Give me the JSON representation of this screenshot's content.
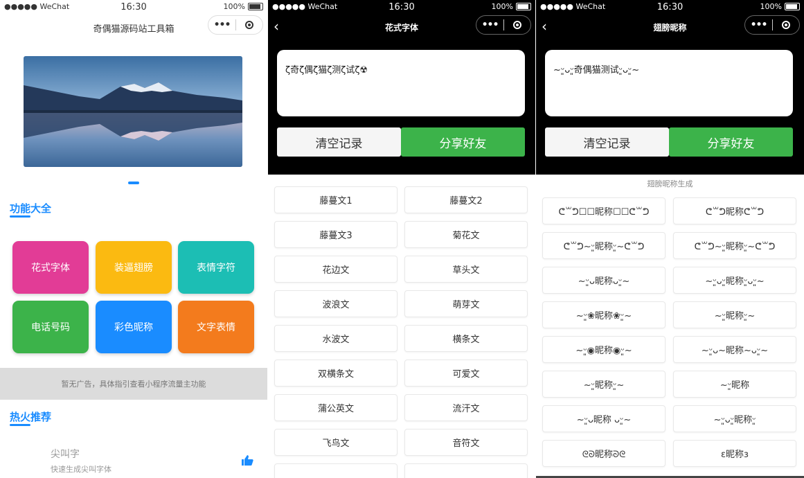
{
  "status": {
    "carrier": "●●●●● WeChat",
    "time": "16:30",
    "battery": "100%"
  },
  "screen1": {
    "title": "奇偶猫源码站工具箱",
    "functions_title": "功能大全",
    "tiles": [
      {
        "label": "花式字体",
        "color": "#e23c96"
      },
      {
        "label": "装逼翅膀",
        "color": "#fbba11"
      },
      {
        "label": "表情字符",
        "color": "#1cbeb4"
      },
      {
        "label": "电话号码",
        "color": "#3cb34a"
      },
      {
        "label": "彩色昵称",
        "color": "#1a8cff"
      },
      {
        "label": "文字表情",
        "color": "#f37b1d"
      }
    ],
    "ad_text": "暂无广告，具体指引查看小程序流量主功能",
    "hot_title": "热火推荐",
    "hot_item": {
      "name": "尖叫字",
      "desc": "快速生成尖叫字体"
    }
  },
  "screen2": {
    "title": "花式字体",
    "input_value": "ζ奇ζ偶ζ猫ζ测ζ试ζ☢",
    "clear_label": "清空记录",
    "share_label": "分享好友",
    "styles": [
      "藤蔓文1",
      "藤蔓文2",
      "藤蔓文3",
      "菊花文",
      "花边文",
      "草头文",
      "波浪文",
      "萌芽文",
      "水波文",
      "横条文",
      "双横条文",
      "可爱文",
      "蒲公英文",
      "流汗文",
      "飞鸟文",
      "音符文",
      "…",
      "…"
    ]
  },
  "screen3": {
    "title": "翅膀昵称",
    "input_value": "~ᵕ͈ᴗᵕ͈奇偶猫测试ᵕ͈ᴗᵕ͈~",
    "clear_label": "清空记录",
    "share_label": "分享好友",
    "subhead": "翅膀昵称生成",
    "results": [
      "ᕦ꒳ᕤ☐☐昵称☐☐ᕦ꒳ᕤ",
      "ᕦ꒳ᕤ昵称ᕦ꒳ᕤ",
      "ᕦ꒳ᕤ~ᵕ͈昵称ᵕ͈~ᕦ꒳ᕤ",
      "ᕦ꒳ᕤ~ᵕ͈昵称ᵕ͈~ᕦ꒳ᕤ",
      "~ᵕ͈ᴗ昵称ᴗᵕ͈~",
      "~ᵕ͈ᴗᵕ͈昵称ᵕ͈ᴗᵕ͈~",
      "~ᵕ͈❀昵称❀ᵕ͈~",
      "~ᵕ͈昵称ᵕ͈~",
      "~ᵕ͈◉昵称◉ᵕ͈~",
      "~ᵕ͈ᴗ~昵称~ᴗᵕ͈~",
      "~ᵕ͈昵称ᵕ͈~",
      "~ᵕ͈昵称",
      "~ᵕ͈ᴗ昵称 ᴗᵕ͈~",
      "~ᵕ͈ᴗᵕ͈昵称ᵕ͈",
      "ᘓᘐ昵称ᘐᘓ",
      "ε昵称з"
    ]
  }
}
